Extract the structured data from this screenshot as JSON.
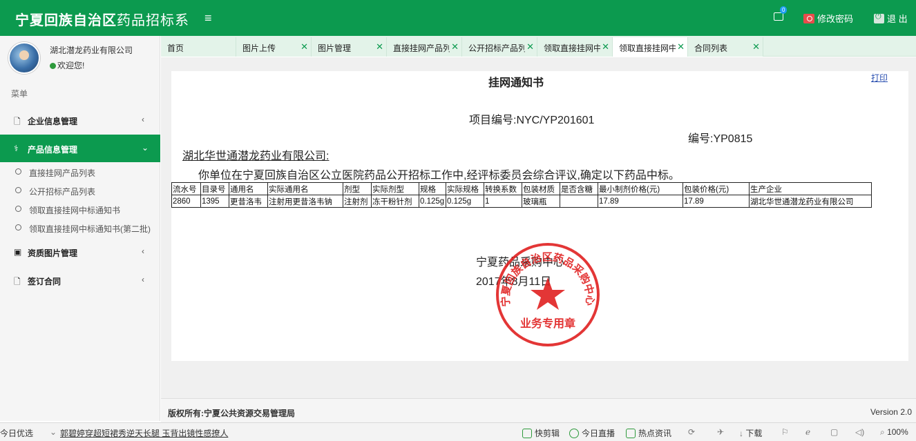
{
  "header": {
    "title_bold": "宁夏回族自治区",
    "title_rest": "药品招标系",
    "menu_icon": "≡",
    "mail_badge": "0",
    "change_password": "修改密码",
    "logout": "退 出"
  },
  "sidebar": {
    "company": "湖北潜龙药业有限公司",
    "welcome": "欢迎您!",
    "menu_header": "菜单",
    "items": [
      {
        "label": "企业信息管理",
        "icon": "document-icon"
      },
      {
        "label": "产品信息管理",
        "icon": "pill-icon"
      },
      {
        "label": "资质图片管理",
        "icon": "image-icon"
      },
      {
        "label": "签订合同",
        "icon": "document-icon"
      }
    ],
    "subitems": [
      "直接挂网产品列表",
      "公开招标产品列表",
      "领取直接挂网中标通知书",
      "领取直接挂网中标通知书(第二批)"
    ]
  },
  "tabs": [
    {
      "label": "首页"
    },
    {
      "label": "图片上传"
    },
    {
      "label": "图片管理"
    },
    {
      "label": "直接挂网产品列"
    },
    {
      "label": "公开招标产品列"
    },
    {
      "label": "领取直接挂网中"
    },
    {
      "label": "领取直接挂网中"
    },
    {
      "label": "合同列表"
    }
  ],
  "doc": {
    "title": "挂网通知书",
    "print": "打印",
    "project_no": "项目编号:NYC/YP201601",
    "doc_no": "编号:YP0815",
    "addressee": "湖北华世通潜龙药业有限公司:",
    "body": "你单位在宁夏回族自治区公立医院药品公开招标工作中,经评标委员会综合评议,确定以下药品中标。",
    "table": {
      "headers": [
        "流水号",
        "目录号",
        "通用名",
        "实际通用名",
        "剂型",
        "实际剂型",
        "规格",
        "实际规格",
        "转换系数",
        "包装材质",
        "是否含糖",
        "最小制剂价格(元)",
        "包装价格(元)",
        "生产企业"
      ],
      "rows": [
        [
          "2860",
          "1395",
          "更昔洛韦",
          "注射用更昔洛韦钠",
          "注射剂",
          "冻干粉针剂",
          "0.125g",
          "0.125g",
          "1",
          "玻璃瓶",
          "",
          "17.89",
          "17.89",
          "湖北华世通潜龙药业有限公司"
        ]
      ]
    },
    "issuer": "宁夏药品采购中心",
    "date": "2017年8月11日",
    "seal_text": "宁夏回族自治区药品采购中心",
    "seal_bottom": "业务专用章"
  },
  "footer": {
    "copyright": "版权所有:宁夏公共资源交易管理局",
    "version": "Version 2.0"
  },
  "statusbar": {
    "left": "今日优选",
    "news": "郭碧婷穿超短裙秀逆天长腿 玉背出镜性感撩人",
    "quick_cut": "快剪辑",
    "live": "今日直播",
    "hot": "热点资讯",
    "download": "下载",
    "zoom": "100%"
  }
}
